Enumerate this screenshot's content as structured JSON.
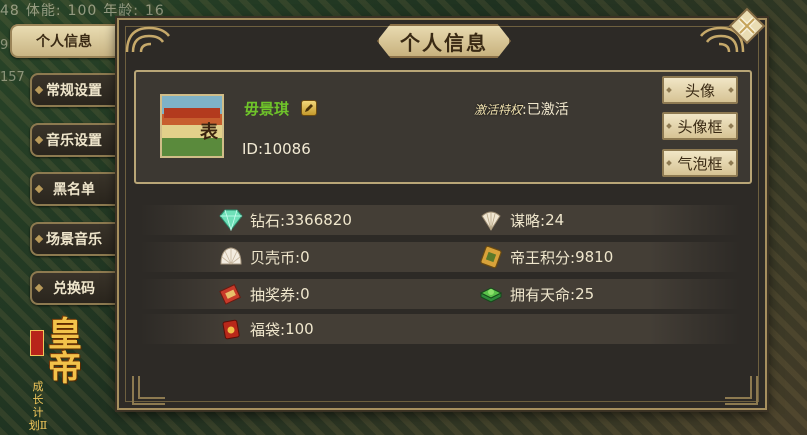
{
  "background": {
    "stats_line": [
      "48",
      "体能:",
      "100",
      "年龄:",
      "16"
    ],
    "stat_2": "9",
    "stat_3": "157"
  },
  "tabs": [
    {
      "label": "个人信息",
      "active": true
    },
    {
      "label": "常规设置",
      "active": false
    },
    {
      "label": "音乐设置",
      "active": false
    },
    {
      "label": "黑名单",
      "active": false
    },
    {
      "label": "场景音乐",
      "active": false
    },
    {
      "label": "兑换码",
      "active": false
    }
  ],
  "logo": {
    "main": "皇帝",
    "sub": "成长计划Ⅱ"
  },
  "panel": {
    "title": "个人信息"
  },
  "profile": {
    "name": "毋景琪",
    "id_text": "ID:10086",
    "vip_script": "激活特权",
    "vip_status": ":已激活",
    "buttons": [
      "头像",
      "头像框",
      "气泡框"
    ]
  },
  "resources": [
    {
      "icon": "diamond-icon",
      "label": "钻石:",
      "value": "3366820"
    },
    {
      "icon": "feather-fan-icon",
      "label": "谋略:",
      "value": "24"
    },
    {
      "icon": "shell-icon",
      "label": "贝壳币:",
      "value": "0"
    },
    {
      "icon": "emperor-badge-icon",
      "label": "帝王积分:",
      "value": "9810"
    },
    {
      "icon": "lottery-ticket-icon",
      "label": "抽奖券:",
      "value": "0"
    },
    {
      "icon": "jade-seal-icon",
      "label": "拥有天命:",
      "value": "25"
    },
    {
      "icon": "lucky-bag-icon",
      "label": "福袋:",
      "value": "100"
    }
  ],
  "colors": {
    "name": "#6fc42a",
    "panel_bg": "#2d2a26",
    "gold_border": "#a68f5e",
    "parchment": "#e8dab0"
  }
}
